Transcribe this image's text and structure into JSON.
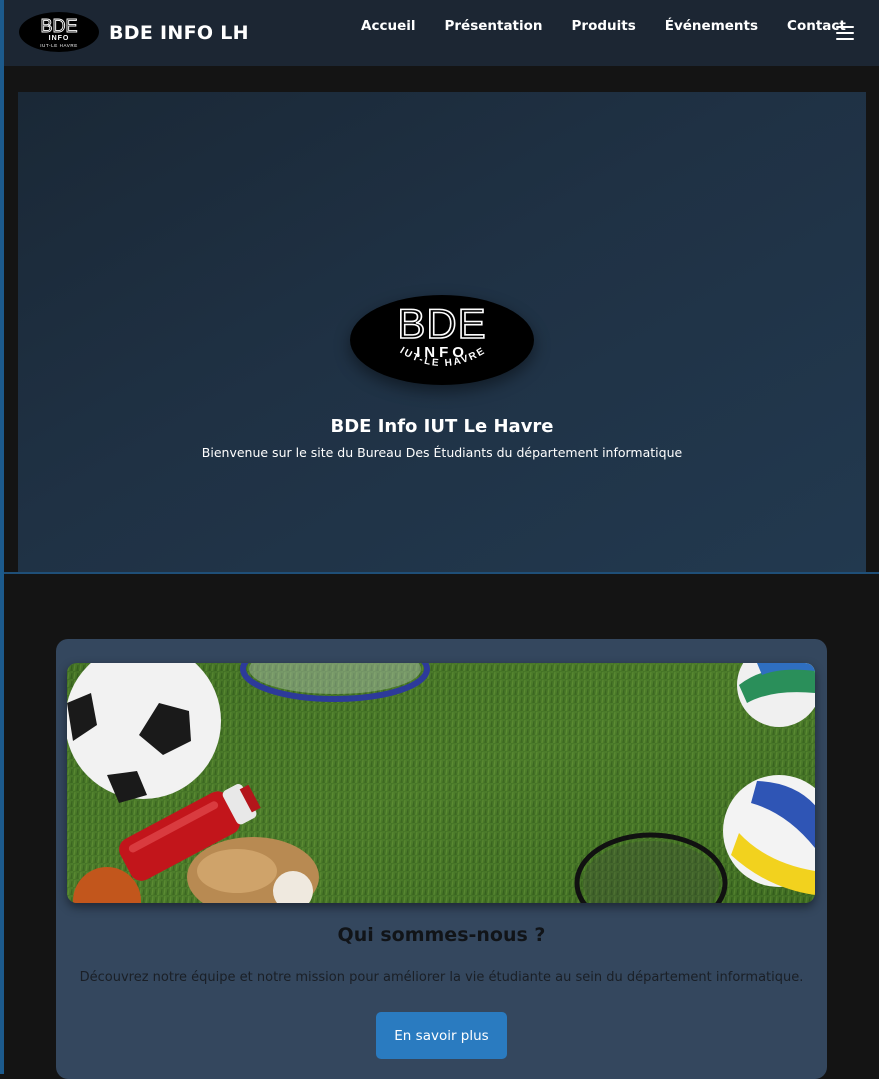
{
  "colors": {
    "page_bg": "#141414",
    "navbar_bg": "#1c2633",
    "hero_bg": "#1f3144",
    "card_bg": "#34475e",
    "button_bg": "#2a7bc0",
    "accent": "#1c5a8c"
  },
  "navbar": {
    "logo": {
      "line1": "BDE",
      "line2": "INFO",
      "line3": "IUT-LE HAVRE"
    },
    "brand": "BDE INFO LH",
    "links": [
      "Accueil",
      "Présentation",
      "Produits",
      "Événements",
      "Contact"
    ],
    "menu_icon": "hamburger-menu-icon"
  },
  "hero": {
    "logo": {
      "line1": "BDE",
      "line2": "INFO",
      "line3": "IUT-LE HAVRE"
    },
    "title": "BDE Info IUT Le Havre",
    "subtitle": "Bienvenue sur le site du Bureau Des Étudiants du département informatique"
  },
  "about_card": {
    "image_icon": "sports-equipment-on-grass-image",
    "title": "Qui sommes-nous ?",
    "text": "Découvrez notre équipe et notre mission pour améliorer la vie étudiante au sein du département informatique.",
    "button_label": "En savoir plus"
  }
}
